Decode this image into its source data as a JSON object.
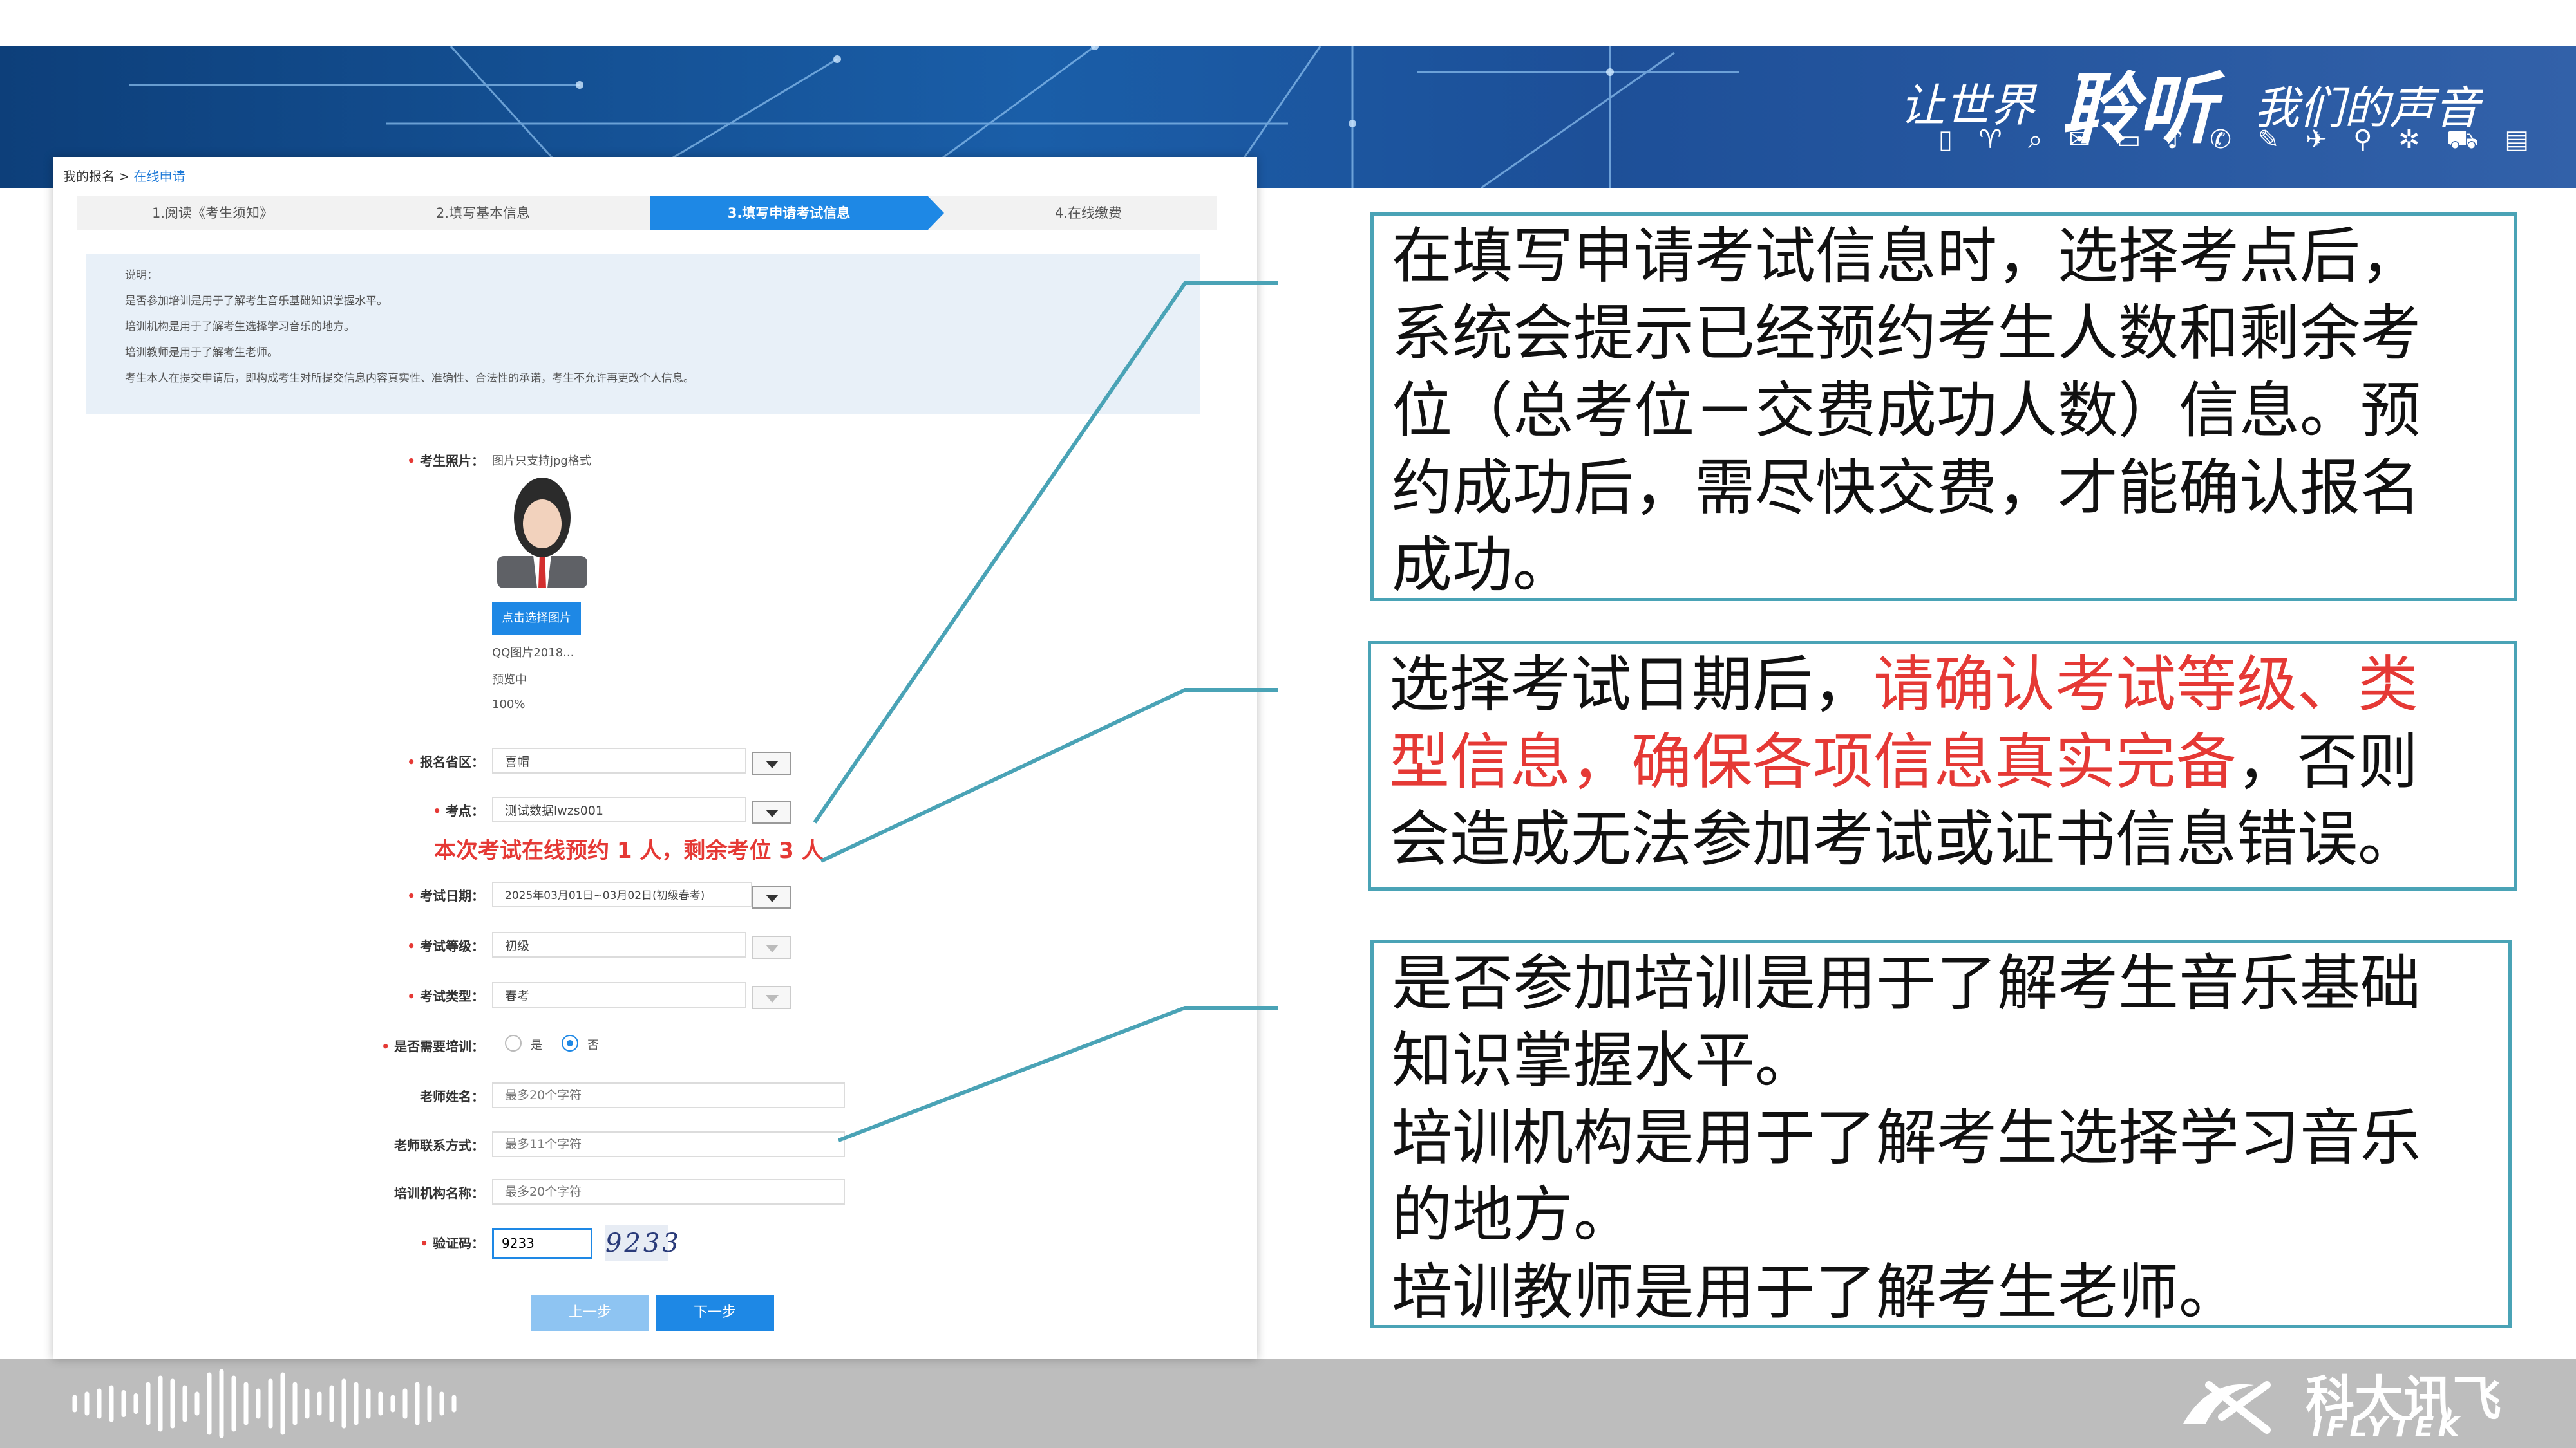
{
  "banner": {
    "slogan_small": "让世界",
    "slogan_big": "聆听",
    "slogan_tail": "我们的声音",
    "icons_row": "▯ ♈ ⌕ ✉ ▭ ♪ ✆   ✎ ✈ ⚲ ✲ ⛟ ▤"
  },
  "screen": {
    "breadcrumb": {
      "home": "我的报名",
      "sep": ">",
      "current": "在线申请"
    },
    "steps": [
      "1.阅读《考生须知》",
      "2.填写基本信息",
      "3.填写申请考试信息",
      "4.在线缴费"
    ],
    "active_step": 2,
    "notes": [
      "说明：",
      "是否参加培训是用于了解考生音乐基础知识掌握水平。",
      "培训机构是用于了解考生选择学习音乐的地方。",
      "培训教师是用于了解考生老师。",
      "考生本人在提交申请后，即构成考生对所提交信息内容真实性、准确性、合法性的承诺，考生不允许再更改个人信息。"
    ],
    "photo": {
      "label": "考生照片：",
      "hint": "图片只支持jpg格式",
      "upload_button": "点击选择图片",
      "file_name": "QQ图片2018...",
      "status": "预览中",
      "progress": "100%"
    },
    "fields": {
      "region": {
        "label": "报名省区：",
        "value": "喜帽"
      },
      "site": {
        "label": "考点：",
        "value": "测试数据lwzs001"
      },
      "hint": "本次考试在线预约 1 人，剩余考位 3 人",
      "date": {
        "label": "考试日期：",
        "value": "2025年03月01日~03月02日(初级春考)"
      },
      "level": {
        "label": "考试等级：",
        "value": "初级"
      },
      "type": {
        "label": "考试类型：",
        "value": "春考"
      },
      "training": {
        "label": "是否需要培训：",
        "opt_yes": "是",
        "opt_no": "否",
        "selected": "否"
      },
      "teacher_name": {
        "label": "老师姓名：",
        "placeholder": "最多20个字符"
      },
      "teacher_contact": {
        "label": "老师联系方式：",
        "placeholder": "最多11个字符"
      },
      "institution": {
        "label": "培训机构名称：",
        "placeholder": "最多20个字符"
      },
      "captcha": {
        "label": "验证码：",
        "value": "9233",
        "image_text": "9233"
      }
    },
    "buttons": {
      "prev": "上一步",
      "next": "下一步"
    }
  },
  "callouts": {
    "c1": [
      "在填写申请考试信息时，选择考点后，",
      "系统会提示已经预约考生人数和剩余考",
      "位（总考位－交费成功人数）信息。预",
      "约成功后，需尽快交费，才能确认报名",
      "成功。"
    ],
    "c2": {
      "l1_a": "选择考试日期后，",
      "l1_b": "请确认考试等级、类",
      "l2_a": "型信息，确保各项信息真实完备",
      "l2_b": "，否则",
      "l3": "会造成无法参加考试或证书信息错误。"
    },
    "c3": [
      "是否参加培训是用于了解考生音乐基础",
      "知识掌握水平。",
      "培训机构是用于了解考生选择学习音乐",
      "的地方。",
      "培训教师是用于了解考生老师。"
    ]
  },
  "footer": {
    "brand_cn": "科大讯飞",
    "brand_en": "IFLYTEK"
  },
  "colors": {
    "accent": "#4aa3b6",
    "primary_blue": "#1e88e5",
    "alert_red": "#e53935",
    "banner_blue": "#1a5ea8",
    "footer_gray": "#bdbdbd"
  }
}
